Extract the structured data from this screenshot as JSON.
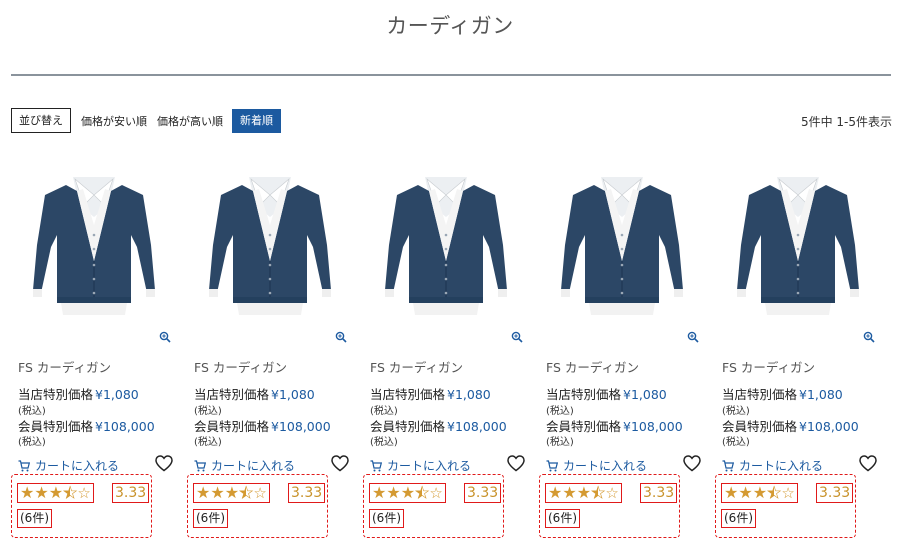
{
  "page": {
    "title": "カーディガン"
  },
  "sort": {
    "label": "並び替え",
    "options": [
      "価格が安い順",
      "価格が高い順",
      "新着順"
    ],
    "active": "新着順"
  },
  "result_count": "5件中 1-5件表示",
  "colors": {
    "accent": "#1c5aa0",
    "star": "#d49a32",
    "highlight": "#e01a1a"
  },
  "products": [
    {
      "name": "FS カーディガン",
      "store_price_label": "当店特別価格",
      "store_price": "¥1,080",
      "tax_note": "(税込)",
      "member_price_label": "会員特別価格",
      "member_price": "¥108,000",
      "member_tax_note": "(税込)",
      "cart_label": "カートに入れる",
      "rating": "3.33",
      "rating_stars": 3.5,
      "review_count": "(6件)"
    },
    {
      "name": "FS カーディガン",
      "store_price_label": "当店特別価格",
      "store_price": "¥1,080",
      "tax_note": "(税込)",
      "member_price_label": "会員特別価格",
      "member_price": "¥108,000",
      "member_tax_note": "(税込)",
      "cart_label": "カートに入れる",
      "rating": "3.33",
      "rating_stars": 3.5,
      "review_count": "(6件)"
    },
    {
      "name": "FS カーディガン",
      "store_price_label": "当店特別価格",
      "store_price": "¥1,080",
      "tax_note": "(税込)",
      "member_price_label": "会員特別価格",
      "member_price": "¥108,000",
      "member_tax_note": "(税込)",
      "cart_label": "カートに入れる",
      "rating": "3.33",
      "rating_stars": 3.5,
      "review_count": "(6件)"
    },
    {
      "name": "FS カーディガン",
      "store_price_label": "当店特別価格",
      "store_price": "¥1,080",
      "tax_note": "(税込)",
      "member_price_label": "会員特別価格",
      "member_price": "¥108,000",
      "member_tax_note": "(税込)",
      "cart_label": "カートに入れる",
      "rating": "3.33",
      "rating_stars": 3.5,
      "review_count": "(6件)"
    },
    {
      "name": "FS カーディガン",
      "store_price_label": "当店特別価格",
      "store_price": "¥1,080",
      "tax_note": "(税込)",
      "member_price_label": "会員特別価格",
      "member_price": "¥108,000",
      "member_tax_note": "(税込)",
      "cart_label": "カートに入れる",
      "rating": "3.33",
      "rating_stars": 3.5,
      "review_count": "(6件)"
    }
  ]
}
